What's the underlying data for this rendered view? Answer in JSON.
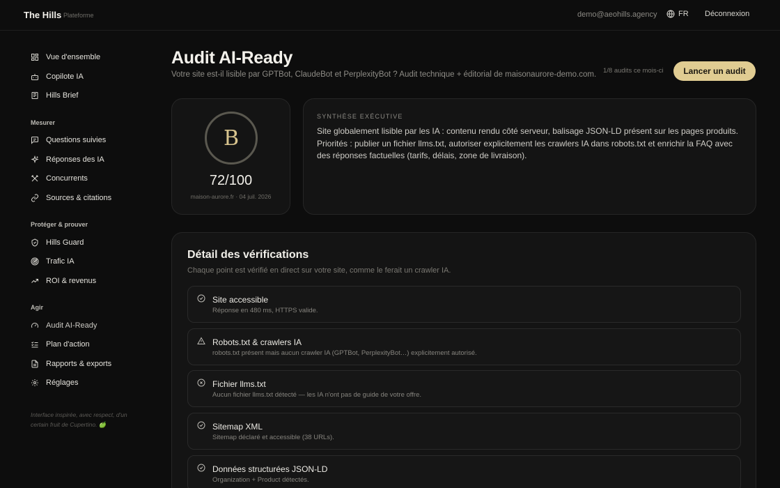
{
  "header": {
    "brand": "The Hills",
    "brand_sub": "Plateforme",
    "email": "demo@aeohills.agency",
    "lang": "FR",
    "logout": "Déconnexion"
  },
  "sidebar": {
    "top_items": [
      {
        "label": "Vue d'ensemble",
        "icon": "dashboard-icon"
      },
      {
        "label": "Copilote IA",
        "icon": "bot-icon"
      },
      {
        "label": "Hills Brief",
        "icon": "newspaper-icon"
      }
    ],
    "sections": [
      {
        "label": "Mesurer",
        "items": [
          {
            "label": "Questions suivies",
            "icon": "message-icon"
          },
          {
            "label": "Réponses des IA",
            "icon": "sparkles-icon"
          },
          {
            "label": "Concurrents",
            "icon": "swords-icon"
          },
          {
            "label": "Sources & citations",
            "icon": "link-icon"
          }
        ]
      },
      {
        "label": "Protéger & prouver",
        "items": [
          {
            "label": "Hills Guard",
            "icon": "shield-icon"
          },
          {
            "label": "Trafic IA",
            "icon": "radar-icon"
          },
          {
            "label": "ROI & revenus",
            "icon": "trending-up-icon"
          }
        ]
      },
      {
        "label": "Agir",
        "items": [
          {
            "label": "Audit AI-Ready",
            "icon": "gauge-icon"
          },
          {
            "label": "Plan d'action",
            "icon": "checklist-icon"
          },
          {
            "label": "Rapports & exports",
            "icon": "file-icon"
          },
          {
            "label": "Réglages",
            "icon": "gear-icon"
          }
        ]
      }
    ],
    "footer": "Interface inspirée, avec respect, d'un certain fruit de Cupertino. 🍏"
  },
  "main": {
    "title": "Audit AI-Ready",
    "subtitle": "Votre site est-il lisible par GPTBot, ClaudeBot et PerplexityBot ? Audit technique + éditorial de maisonaurore-demo.com.",
    "quota": "1/8 audits ce mois-ci",
    "launch_label": "Lancer un audit",
    "score": {
      "grade": "B",
      "value": "72/100",
      "meta": "maison-aurore.fr · 04 juil. 2026"
    },
    "summary": {
      "label": "SYNTHÈSE EXÉCUTIVE",
      "text": "Site globalement lisible par les IA : contenu rendu côté serveur, balisage JSON-LD présent sur les pages produits. Priorités : publier un fichier llms.txt, autoriser explicitement les crawlers IA dans robots.txt et enrichir la FAQ avec des réponses factuelles (tarifs, délais, zone de livraison)."
    },
    "details": {
      "title": "Détail des vérifications",
      "subtitle": "Chaque point est vérifié en direct sur votre site, comme le ferait un crawler IA.",
      "checks": [
        {
          "title": "Site accessible",
          "desc": "Réponse en 480 ms, HTTPS valide.",
          "status": "pass"
        },
        {
          "title": "Robots.txt & crawlers IA",
          "desc": "robots.txt présent mais aucun crawler IA (GPTBot, PerplexityBot…) explicitement autorisé.",
          "status": "warn"
        },
        {
          "title": "Fichier llms.txt",
          "desc": "Aucun fichier llms.txt détecté — les IA n'ont pas de guide de votre offre.",
          "status": "fail"
        },
        {
          "title": "Sitemap XML",
          "desc": "Sitemap déclaré et accessible (38 URLs).",
          "status": "pass"
        },
        {
          "title": "Données structurées JSON-LD",
          "desc": "Organization + Product détectés.",
          "status": "pass"
        }
      ]
    }
  },
  "colors": {
    "accent": "#e0cc92",
    "background": "#0d0d0d"
  }
}
